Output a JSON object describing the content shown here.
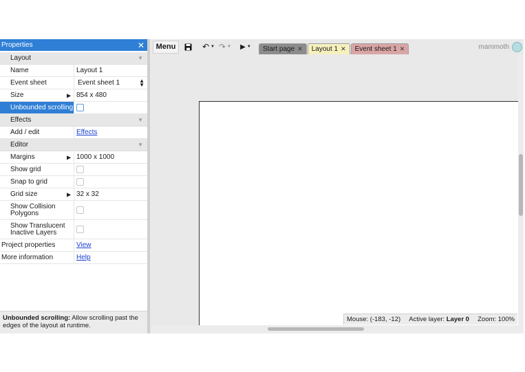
{
  "properties": {
    "title": "Properties",
    "sections": {
      "layout": "Layout",
      "effects": "Effects",
      "editor": "Editor"
    },
    "rows": {
      "name": {
        "label": "Name",
        "value": "Layout 1"
      },
      "event_sheet": {
        "label": "Event sheet",
        "value": "Event sheet 1"
      },
      "size": {
        "label": "Size",
        "value": "854 x 480"
      },
      "unbounded_scrolling": {
        "label": "Unbounded scrolling"
      },
      "add_edit": {
        "label": "Add / edit",
        "value": "Effects"
      },
      "margins": {
        "label": "Margins",
        "value": "1000 x 1000"
      },
      "show_grid": {
        "label": "Show grid"
      },
      "snap_to_grid": {
        "label": "Snap to grid"
      },
      "grid_size": {
        "label": "Grid size",
        "value": "32 x 32"
      },
      "show_collision": {
        "label": "Show Collision Polygons"
      },
      "show_translucent": {
        "label": "Show Translucent Inactive Layers"
      },
      "project_properties": {
        "label": "Project properties",
        "value": "View"
      },
      "more_information": {
        "label": "More information",
        "value": "Help"
      }
    },
    "help": {
      "term": "Unbounded scrolling:",
      "text": " Allow scrolling past the edges of the layout at runtime."
    }
  },
  "toolbar": {
    "menu_label": "Menu",
    "tabs": [
      {
        "label": "Start page"
      },
      {
        "label": "Layout 1"
      },
      {
        "label": "Event sheet 1"
      }
    ],
    "brand": "mammoth"
  },
  "status": {
    "mouse": "Mouse: (-183, -12)",
    "layer_label": "Active layer:",
    "layer_value": "Layer 0",
    "zoom": "Zoom: 100%"
  },
  "colors": {
    "accent": "#2f7fd6",
    "tab_layout": "#f5f0bd",
    "tab_events": "#d9a5a5",
    "tab_start": "#8c8c8c"
  }
}
